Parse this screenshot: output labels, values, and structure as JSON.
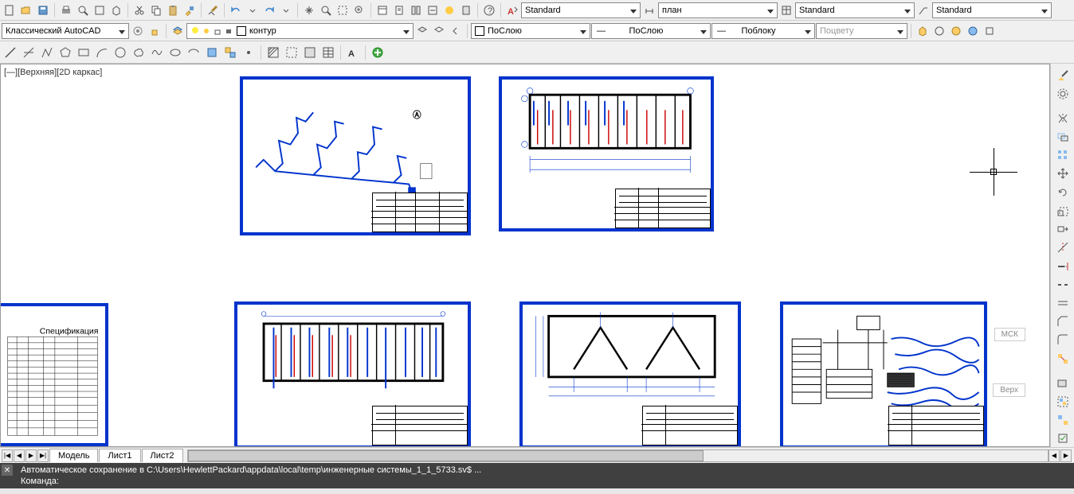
{
  "toolbar1": {
    "style_dropdown1": "Standard",
    "style_dropdown2": "план",
    "style_dropdown3": "Standard",
    "style_dropdown4": "Standard"
  },
  "toolbar2": {
    "workspace": "Классический AutoCAD",
    "layer_name": "контур",
    "layer_prop": "ПоСлою",
    "linetype": "ПоСлою",
    "lineweight": "Поблоку",
    "plot_style": "Поцвету"
  },
  "viewport": {
    "label": "[—][Верхняя][2D каркас]",
    "mck_label": "МСК",
    "view_label": "Верх"
  },
  "tabs": {
    "nav": [
      "|◀",
      "◀",
      "▶",
      "▶|"
    ],
    "items": [
      "Модель",
      "Лист1",
      "Лист2"
    ],
    "active": 0
  },
  "command": {
    "autosave_line": "Автоматическое сохранение в C:\\Users\\HewlettPackard\\appdata\\local\\temp\\инженерные системы_1_1_5733.sv$ ...",
    "prompt": "Команда:"
  },
  "icons": {
    "top_row": [
      "new",
      "open",
      "save",
      "print",
      "preview",
      "find",
      "xref",
      "cut",
      "copy",
      "paste",
      "match",
      "brush",
      "undo",
      "redo",
      "pan",
      "zoom",
      "zoom-win",
      "zoom-prev",
      "props",
      "sheet",
      "tool",
      "calc",
      "render",
      "qcalc",
      "help",
      "text-style",
      "dim-style",
      "table-style",
      "mleader-style"
    ],
    "draw_row": [
      "line",
      "construction",
      "polyline",
      "polygon",
      "rectangle",
      "arc",
      "circle",
      "cloud",
      "spline",
      "ellipse",
      "ellipse-arc",
      "insert",
      "block",
      "point",
      "hatch",
      "gradient",
      "region",
      "table-draw",
      "text",
      "add-sel"
    ],
    "right_col": [
      "brush2",
      "settings",
      "mirror",
      "rotate",
      "fillet",
      "trim",
      "move",
      "copy2",
      "array",
      "scale",
      "offset",
      "stretch",
      "chamfer",
      "explode",
      "join",
      "break",
      "extend",
      "align",
      "wipeout",
      "group",
      "ungroup",
      "select"
    ]
  }
}
